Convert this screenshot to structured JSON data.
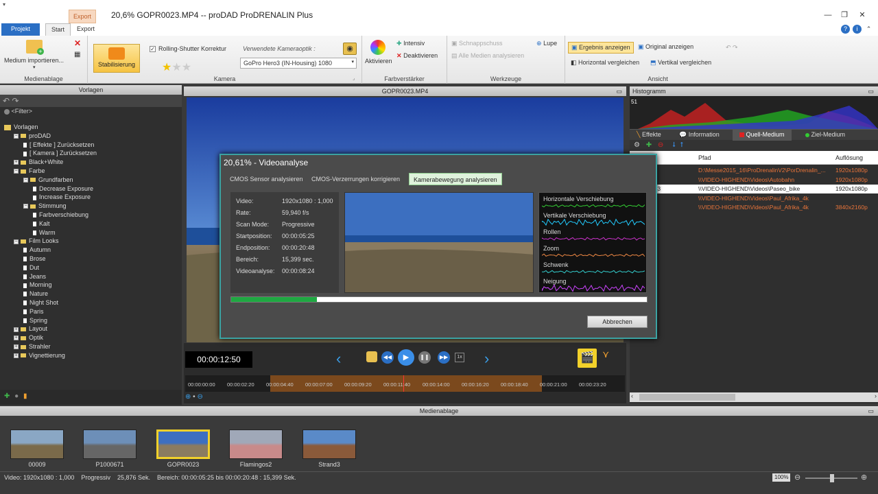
{
  "app": {
    "title": "20,6%  GOPR0023.MP4 -- proDAD ProDRENALIN Plus",
    "context_tab": "Export",
    "tabs": [
      "Projekt",
      "Start",
      "Export"
    ]
  },
  "ribbon": {
    "medienablage": {
      "import_label": "Medium importieren...",
      "caption": "Medienablage"
    },
    "kamera": {
      "stabilisierung": "Stabilisierung",
      "rolling_shutter": "Rolling-Shutter Korrektur",
      "optik_label": "Verwendete Kameraoptik :",
      "optik_value": "GoPro Hero3 (IN-Housing) 1080",
      "caption": "Kamera"
    },
    "farbverstaerker": {
      "aktivieren": "Aktivieren",
      "intensiv": "Intensiv",
      "deaktivieren": "Deaktivieren",
      "caption": "Farbverstärker"
    },
    "werkzeuge": {
      "schnappschuss": "Schnappschuss",
      "alle_medien": "Alle Medien analysieren",
      "lupe": "Lupe",
      "caption": "Werkzeuge"
    },
    "ansicht": {
      "ergebnis": "Ergebnis anzeigen",
      "original": "Original anzeigen",
      "horizontal": "Horizontal vergleichen",
      "vertikal": "Vertikal vergleichen",
      "caption": "Ansicht"
    }
  },
  "left_panel": {
    "header": "Vorlagen",
    "filter": "<Filter>",
    "tree": [
      {
        "label": "Vorlagen",
        "indent": 0,
        "kind": "root"
      },
      {
        "label": "proDAD",
        "indent": 1,
        "kind": "folder"
      },
      {
        "label": "[ Effekte ]  Zurücksetzen",
        "indent": 2,
        "kind": "doc"
      },
      {
        "label": "[ Kamera ]  Zurücksetzen",
        "indent": 2,
        "kind": "doc"
      },
      {
        "label": "Black+White",
        "indent": 1,
        "kind": "folder"
      },
      {
        "label": "Farbe",
        "indent": 1,
        "kind": "folder"
      },
      {
        "label": "Grundfarben",
        "indent": 2,
        "kind": "folder"
      },
      {
        "label": "Decrease Exposure",
        "indent": 3,
        "kind": "doc"
      },
      {
        "label": "Increase Exposure",
        "indent": 3,
        "kind": "doc"
      },
      {
        "label": "Stimmung",
        "indent": 2,
        "kind": "folder"
      },
      {
        "label": "Farbverschiebung",
        "indent": 3,
        "kind": "doc"
      },
      {
        "label": "Kalt",
        "indent": 3,
        "kind": "doc"
      },
      {
        "label": "Warm",
        "indent": 3,
        "kind": "doc"
      },
      {
        "label": "Film Looks",
        "indent": 1,
        "kind": "folder"
      },
      {
        "label": "Autumn",
        "indent": 2,
        "kind": "doc"
      },
      {
        "label": "Brose",
        "indent": 2,
        "kind": "doc"
      },
      {
        "label": "Dut",
        "indent": 2,
        "kind": "doc"
      },
      {
        "label": "Jeans",
        "indent": 2,
        "kind": "doc"
      },
      {
        "label": "Morning",
        "indent": 2,
        "kind": "doc"
      },
      {
        "label": "Nature",
        "indent": 2,
        "kind": "doc"
      },
      {
        "label": "Night Shot",
        "indent": 2,
        "kind": "doc"
      },
      {
        "label": "Paris",
        "indent": 2,
        "kind": "doc"
      },
      {
        "label": "Spring",
        "indent": 2,
        "kind": "doc"
      },
      {
        "label": "Layout",
        "indent": 1,
        "kind": "folder"
      },
      {
        "label": "Optik",
        "indent": 1,
        "kind": "folder"
      },
      {
        "label": "Strahler",
        "indent": 1,
        "kind": "folder"
      },
      {
        "label": "Vignettierung",
        "indent": 1,
        "kind": "folder"
      }
    ]
  },
  "center": {
    "header": "GOPR0023.MP4",
    "timecode": "00:00:12:50",
    "speed": "1x",
    "ticks": [
      "00:00:00:00",
      "00:00:02:20",
      "00:00:04:40",
      "00:00:07:00",
      "00:00:09:20",
      "00:00:11:40",
      "00:00:14:00",
      "00:00:16:20",
      "00:00:18:40",
      "00:00:21:00",
      "00:00:23:20"
    ]
  },
  "dialog": {
    "title": "20,61% - Videoanalyse",
    "tabs": [
      "CMOS Sensor analysieren",
      "CMOS-Verzerrungen korrigieren",
      "Kamerabewegung analysieren"
    ],
    "info": [
      {
        "k": "Video:",
        "v": "1920x1080 : 1,000"
      },
      {
        "k": "Rate:",
        "v": "59,940 f/s"
      },
      {
        "k": "Scan Mode:",
        "v": "Progressive"
      },
      {
        "k": "Startposition:",
        "v": "00:00:05:25"
      },
      {
        "k": "Endposition:",
        "v": "00:00:20:48"
      },
      {
        "k": "Bereich:",
        "v": "15,399 sec."
      },
      {
        "k": "Videoanalyse:",
        "v": "00:00:08:24"
      }
    ],
    "graphs": [
      "Horizontale Verschiebung",
      "Vertikale Verschiebung",
      "Rollen",
      "Zoom",
      "Schwenk",
      "Neigung"
    ],
    "progress": 0.206,
    "cancel": "Abbrechen"
  },
  "right_panel": {
    "histogram_header": "Histogramm",
    "histogram_value": "51",
    "tabs": [
      "Effekte",
      "Information",
      "Quell-Medium",
      "Ziel-Medium"
    ],
    "columns": [
      "Pfad",
      "Auflösung"
    ],
    "rows": [
      {
        "name": "",
        "path": "D:\\Messe2015_16\\ProDrenalinV2\\PorDrenalin_...",
        "res": "1920x1080p",
        "state": "orange"
      },
      {
        "name": "0671",
        "path": "\\\\VIDEO-HIGHEND\\Videos\\Autobahn",
        "res": "1920x1080p",
        "state": "orange"
      },
      {
        "name": "R0023",
        "path": "\\\\VIDEO-HIGHEND\\Videos\\Paseo_bike",
        "res": "1920x1080p",
        "state": "selected"
      },
      {
        "name": "igos2",
        "path": "\\\\VIDEO-HIGHEND\\Videos\\Paul_Afrika_4k",
        "res": "",
        "state": "orange"
      },
      {
        "name": "3",
        "path": "\\\\VIDEO-HIGHEND\\Videos\\Paul_Afrika_4k",
        "res": "3840x2160p",
        "state": "orange"
      }
    ]
  },
  "media_bar": {
    "header": "Medienablage",
    "items": [
      {
        "label": "00009",
        "selected": false
      },
      {
        "label": "P1000671",
        "selected": false
      },
      {
        "label": "GOPR0023",
        "selected": true
      },
      {
        "label": "Flamingos2",
        "selected": false
      },
      {
        "label": "Strand3",
        "selected": false
      }
    ]
  },
  "status": {
    "text": "Video: 1920x1080 : 1,000    Progressiv    25,876 Sek.    Bereich: 00:00:05:25 bis 00:00:20:48 : 15,399 Sek.",
    "zoom": "100%"
  },
  "colors": {
    "accent": "#2b6fc4",
    "highlight": "#f2d12a",
    "dialog_border": "#3aa3a3",
    "progress": "#1fa842"
  }
}
